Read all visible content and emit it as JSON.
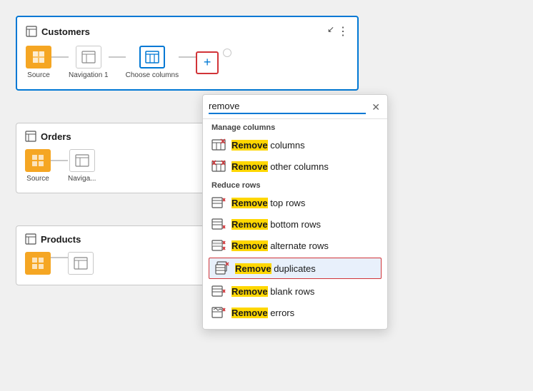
{
  "cards": [
    {
      "id": "customers",
      "title": "Customers",
      "active": true,
      "steps": [
        {
          "label": "Source",
          "type": "orange"
        },
        {
          "label": "Navigation 1",
          "type": "grey"
        },
        {
          "label": "Choose columns",
          "type": "blue-outline"
        }
      ]
    },
    {
      "id": "orders",
      "title": "Orders",
      "active": false,
      "steps": [
        {
          "label": "Source",
          "type": "orange"
        },
        {
          "label": "Naviga...",
          "type": "grey"
        }
      ]
    },
    {
      "id": "products",
      "title": "Products",
      "active": false,
      "steps": [
        {
          "label": "",
          "type": "orange"
        },
        {
          "label": "",
          "type": "grey"
        }
      ]
    }
  ],
  "dropdown": {
    "search_value": "remove",
    "search_placeholder": "Search",
    "clear_label": "×",
    "sections": [
      {
        "header": "Manage columns",
        "items": [
          {
            "label": "Remove columns",
            "highlight": "Remove"
          },
          {
            "label": "Remove other columns",
            "highlight": "Remove"
          }
        ]
      },
      {
        "header": "Reduce rows",
        "items": [
          {
            "label": "Remove top rows",
            "highlight": "Remove"
          },
          {
            "label": "Remove bottom rows",
            "highlight": "Remove"
          },
          {
            "label": "Remove alternate rows",
            "highlight": "Remove"
          },
          {
            "label": "Remove duplicates",
            "highlight": "Remove",
            "selected": true
          },
          {
            "label": "Remove blank rows",
            "highlight": "Remove"
          },
          {
            "label": "Remove errors",
            "highlight": "Remove"
          }
        ]
      }
    ]
  }
}
